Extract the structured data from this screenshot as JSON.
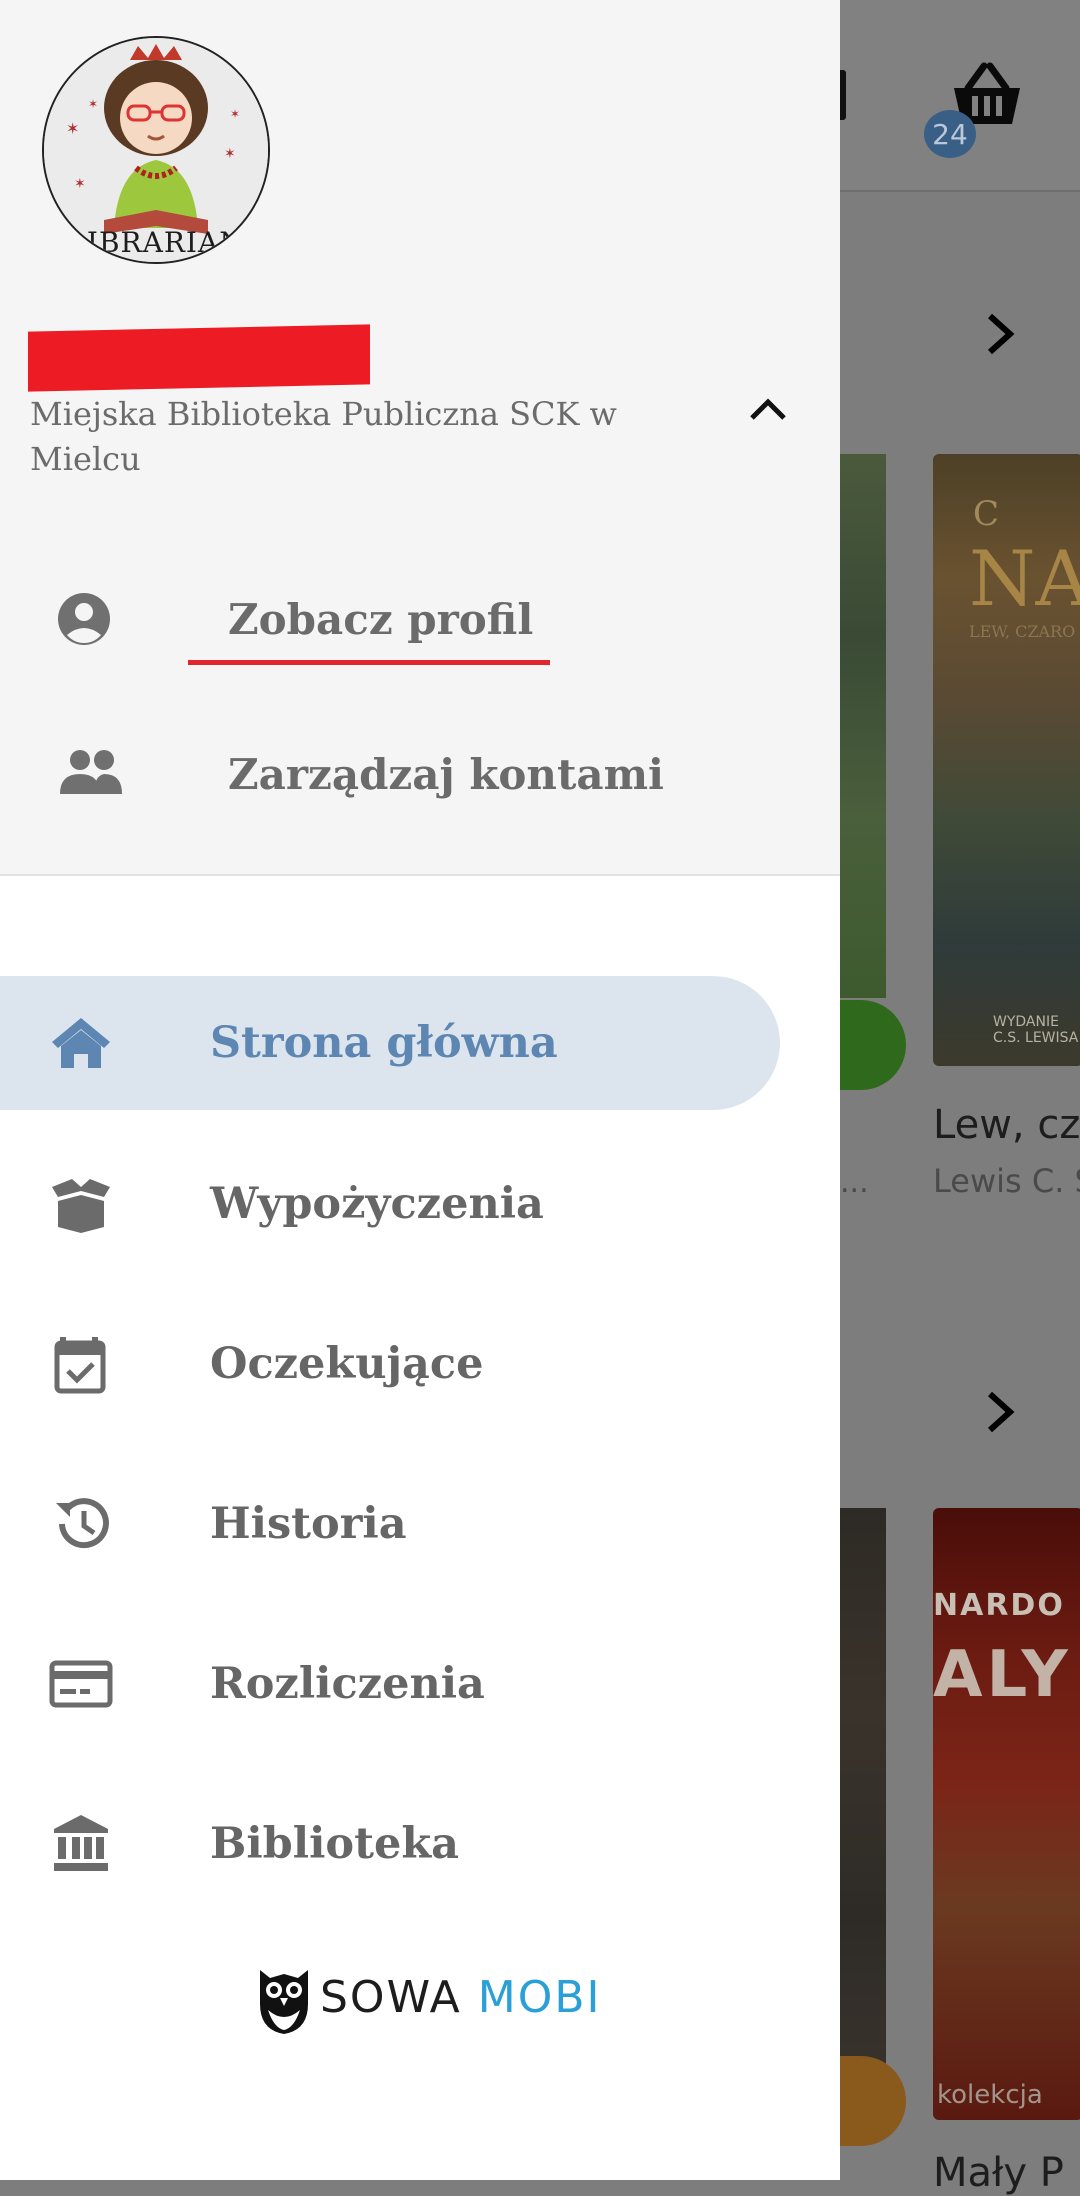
{
  "background": {
    "cart_badge": "24",
    "book_cover_1": {
      "line1": "C",
      "line2": "NA",
      "line3": "LEW, CZARO",
      "line4": "WYDANIE\nC.S. LEWISA"
    },
    "book_cover_2": {
      "line1": "NARDO",
      "line2": "ALY",
      "line3": "kolekcja"
    },
    "book_title_1": "Lew, cz",
    "book_author_1": "Lewis C. S",
    "ellipsis": "...",
    "book_title_2": "Mały P"
  },
  "drawer": {
    "avatar_label": "LIBRARIAN",
    "library_name": "Miejska Biblioteka Publiczna SCK w Mielcu",
    "account_menu": [
      {
        "label": "Zobacz profil",
        "icon": "account-circle-icon"
      },
      {
        "label": "Zarządzaj kontami",
        "icon": "people-icon"
      }
    ],
    "nav": [
      {
        "label": "Strona główna",
        "icon": "home-icon",
        "active": true
      },
      {
        "label": "Wypożyczenia",
        "icon": "box-icon",
        "active": false
      },
      {
        "label": "Oczekujące",
        "icon": "calendar-check-icon",
        "active": false
      },
      {
        "label": "Historia",
        "icon": "history-icon",
        "active": false
      },
      {
        "label": "Rozliczenia",
        "icon": "credit-card-icon",
        "active": false
      },
      {
        "label": "Biblioteka",
        "icon": "library-icon",
        "active": false
      }
    ],
    "brand": {
      "part1": "SOWA ",
      "part2": "MOBI"
    }
  },
  "colors": {
    "accent_active": "#5e86b2",
    "active_bg": "#dce5ee",
    "underline": "#e3262d",
    "brand_blue": "#2a9fd8"
  }
}
